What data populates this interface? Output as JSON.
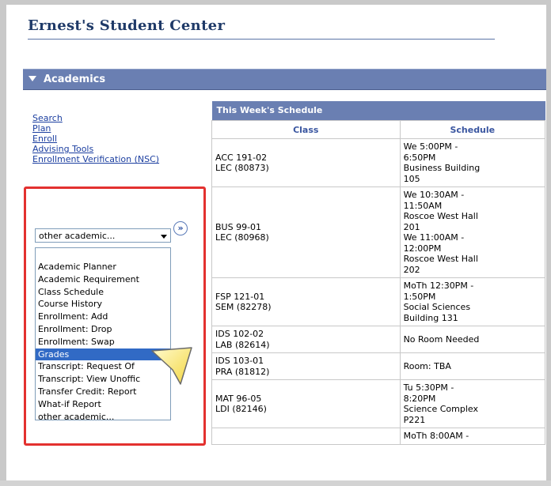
{
  "page": {
    "title": "Ernest's Student Center"
  },
  "section": {
    "title": "Academics"
  },
  "links": [
    "Search",
    "Plan",
    "Enroll",
    "Advising Tools",
    "Enrollment Verification (NSC)"
  ],
  "academic_select": {
    "selected_value": "other academic...",
    "go_icon": "double-chevron-right-icon",
    "go_glyph": "»",
    "options": [
      "Academic Planner",
      "Academic Requirement",
      "Class Schedule",
      "Course History",
      "Enrollment: Add",
      "Enrollment: Drop",
      "Enrollment: Swap",
      "Grades",
      "Transcript: Request Of",
      "Transcript: View Unoffic",
      "Transfer Credit: Report",
      "What-if Report",
      "other academic..."
    ],
    "highlighted_option": "Grades"
  },
  "schedule": {
    "title": "This Week's Schedule",
    "headers": [
      "Class",
      "Schedule"
    ],
    "rows": [
      {
        "class": [
          "ACC 191-02",
          "LEC (80873)"
        ],
        "schedule": [
          "We 5:00PM -",
          "6:50PM",
          "Business Building",
          "105"
        ]
      },
      {
        "class": [
          "BUS 99-01",
          "LEC (80968)"
        ],
        "schedule": [
          "We 10:30AM -",
          "11:50AM",
          "Roscoe West Hall",
          "201",
          "We 11:00AM -",
          "12:00PM",
          "Roscoe West Hall",
          "202"
        ]
      },
      {
        "class": [
          "FSP 121-01",
          "SEM (82278)"
        ],
        "schedule": [
          "MoTh 12:30PM -",
          "1:50PM",
          "Social Sciences",
          "Building 131"
        ]
      },
      {
        "class": [
          "IDS 102-02",
          "LAB (82614)"
        ],
        "schedule": [
          "No Room Needed"
        ]
      },
      {
        "class": [
          "IDS 103-01",
          "PRA (81812)"
        ],
        "schedule": [
          "Room:  TBA"
        ]
      },
      {
        "class": [
          "MAT 96-05",
          "LDI (82146)"
        ],
        "schedule": [
          "Tu 5:30PM -",
          "8:20PM",
          "Science Complex",
          "P221"
        ]
      },
      {
        "class": [],
        "schedule": [
          "MoTh 8:00AM -"
        ]
      }
    ]
  },
  "colors": {
    "section_bar": "#6a7fb2",
    "title": "#1f3a68",
    "link": "#1c3fa0",
    "highlight_border": "#e3312f",
    "selected_option": "#316ac5"
  }
}
